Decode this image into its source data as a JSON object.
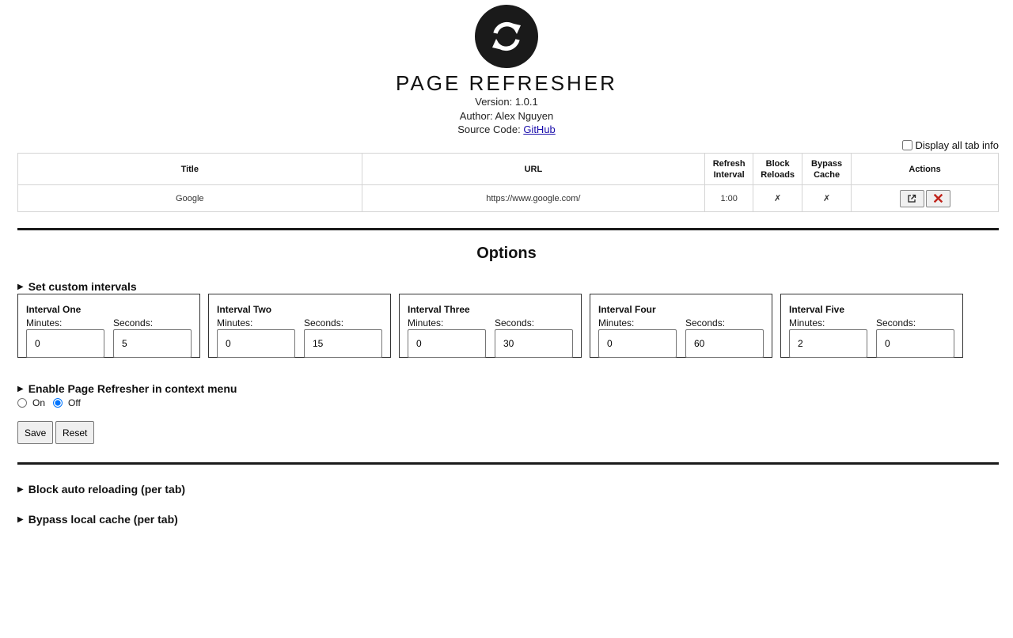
{
  "app": {
    "title": "PAGE REFRESHER",
    "version": "Version: 1.0.1",
    "author": "Author: Alex Nguyen",
    "source_label": "Source Code: ",
    "source_link": "GitHub"
  },
  "display_all": {
    "label": "Display all tab info",
    "checked": false
  },
  "table": {
    "headers": {
      "title": "Title",
      "url": "URL",
      "refresh_1": "Refresh",
      "refresh_2": "Interval",
      "block_1": "Block",
      "block_2": "Reloads",
      "bypass_1": "Bypass",
      "bypass_2": "Cache",
      "actions": "Actions"
    },
    "rows": [
      {
        "title": "Google",
        "url": "https://www.google.com/",
        "interval": "1:00",
        "block": "✗",
        "bypass": "✗"
      }
    ]
  },
  "options": {
    "title": "Options",
    "custom_intervals_label": "Set custom intervals",
    "minutes_label": "Minutes:",
    "seconds_label": "Seconds:",
    "intervals": [
      {
        "name": "Interval One",
        "minutes": "0",
        "seconds": "5"
      },
      {
        "name": "Interval Two",
        "minutes": "0",
        "seconds": "15"
      },
      {
        "name": "Interval Three",
        "minutes": "0",
        "seconds": "30"
      },
      {
        "name": "Interval Four",
        "minutes": "0",
        "seconds": "60"
      },
      {
        "name": "Interval Five",
        "minutes": "2",
        "seconds": "0"
      }
    ],
    "context_menu_label": "Enable Page Refresher in context menu",
    "on_label": "On",
    "off_label": "Off",
    "context_menu_value": "off",
    "save_label": "Save",
    "reset_label": "Reset"
  },
  "sections": {
    "block_label": "Block auto reloading (per tab)",
    "bypass_label": "Bypass local cache (per tab)"
  }
}
